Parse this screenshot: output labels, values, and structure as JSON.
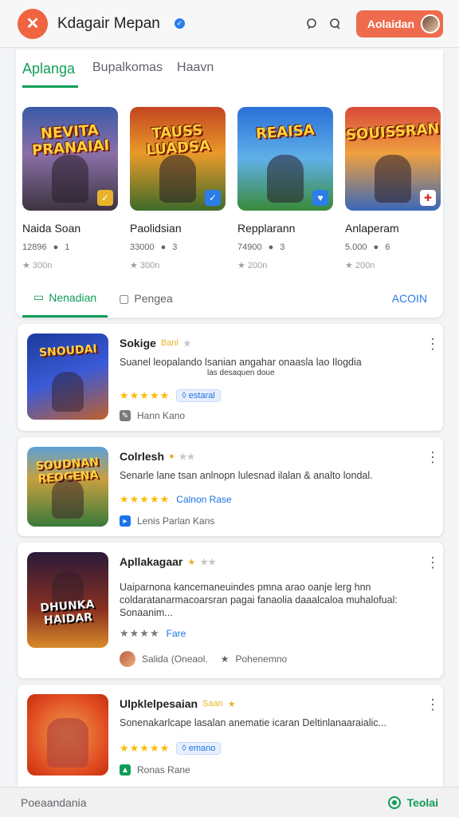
{
  "header": {
    "title": "Kdagair Mepan",
    "logo_glyph": "✕",
    "action_label": "Aolaidan",
    "search_icon": "search-icon",
    "chat_icon": "chat-icon"
  },
  "tabs": [
    {
      "label": "Aplanga"
    },
    {
      "label": "Bupalkomas"
    },
    {
      "label": "Haavn"
    }
  ],
  "games": [
    {
      "art": "NEVITA PRANAIAI",
      "name": "Naida Soan",
      "downloads": "12896",
      "count": "1",
      "rating": "300n"
    },
    {
      "art": "TAUSS LUADSA",
      "name": "Paolidsian",
      "downloads": "33000",
      "count": "3",
      "rating": "300n"
    },
    {
      "art": "REAISA",
      "name": "Repplarann",
      "downloads": "74900",
      "count": "3",
      "rating": "200n"
    },
    {
      "art": "SOUISSRAN",
      "name": "Anlaperam",
      "downloads": "5.000",
      "count": "6",
      "rating": "200n"
    }
  ],
  "subtabs": {
    "first": "Nenadian",
    "second": "Pengea",
    "action": "ACOIN"
  },
  "cards": [
    {
      "art": "SNOUDAI",
      "title": "Sokige",
      "badge": "Banl",
      "desc": "Suanel leopalando lsanian angahar onaasla lao Ilogdia",
      "desc2": "las desaquen doue",
      "stars": "★★★★★",
      "pill": "estaral",
      "meta": "Hann Kano"
    },
    {
      "art": "SOUDNAN REOGENA",
      "title": "Colrlesh",
      "badge": "",
      "desc": "Senarle lane tsan anlnopn lulesnad ilalan & analto londal.",
      "stars": "★★★★★",
      "link": "Calnon Rase",
      "meta": "Lenis Parlan Kans"
    },
    {
      "art": "DHUNKA HAIDAR",
      "title": "Apllakagaar",
      "badge": "",
      "desc": "Uaiparnona kancemaneuindes pmna arao oanje lerg hnn coldaratanarmacoarsran pagai fanaolia daaalcaloa muhalofual: Sonaanim...",
      "stars": "★★★★",
      "link": "Fare",
      "meta_user": "Salida (Oneaol.",
      "meta_fav": "Pohenemno"
    },
    {
      "art": "",
      "title": "Ulpklelpesaian",
      "badge": "Saan",
      "desc": "Sonenakarlcape lasalan anematie icaran Deltinlanaaraialic...",
      "stars": "★★★★★",
      "pill": "emano",
      "meta": "Ronas Rane"
    }
  ],
  "footer": {
    "left": "Poeaandania",
    "right": "Teolai"
  },
  "colors": {
    "accent_green": "#0f9d58",
    "brand_orange": "#ef6b4d",
    "link_blue": "#1a73e8",
    "star_yellow": "#fbbc04"
  }
}
